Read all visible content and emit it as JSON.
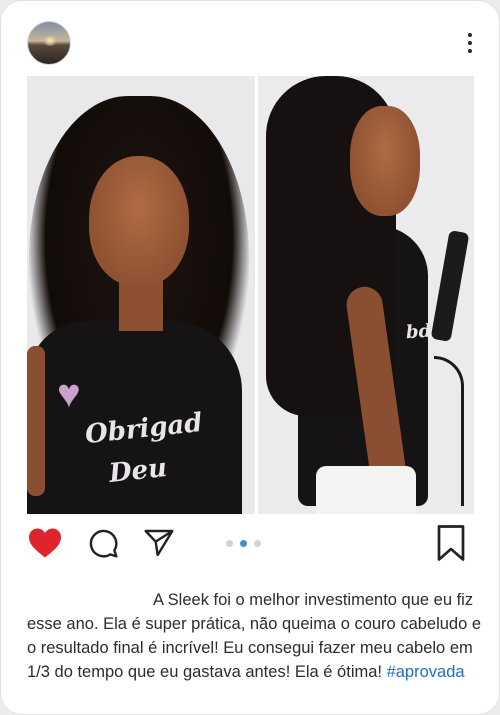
{
  "post": {
    "caption": "A Sleek foi o melhor investimento que eu fiz esse ano. Ela é super prática, não queima o couro cabeludo e o resultado final é incrível! Eu consegui fazer meu cabelo em 1/3 do tempo que eu gastava antes! Ela é ótima!",
    "hashtag": "#aprovada",
    "shirt_text_left_1": "Obrigad",
    "shirt_text_left_2": "Deu",
    "shirt_text_right": "bda",
    "carousel": {
      "count": 3,
      "active_index": 1
    }
  },
  "actions": {
    "liked": true,
    "icons": [
      "heart-icon",
      "comment-icon",
      "share-icon",
      "bookmark-icon"
    ]
  },
  "colors": {
    "like": "#e0242b",
    "hashtag": "#1f6fbf",
    "dot_active": "#3b8fd6",
    "dot_inactive": "#d3d3d3"
  }
}
